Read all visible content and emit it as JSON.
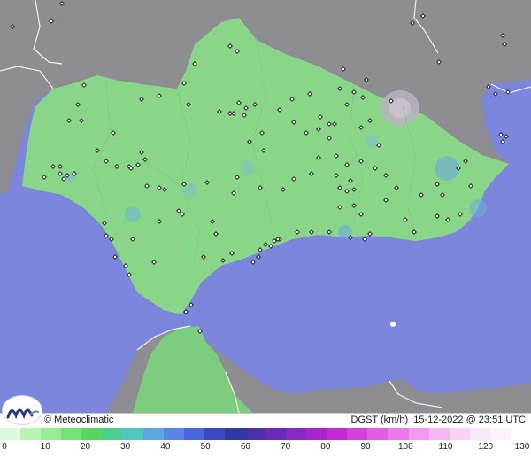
{
  "map": {
    "brand": "© Meteoclimatic",
    "variable": "DGST (km/h)",
    "datetime": "15-12-2022 @ 23:51 UTC",
    "colors": {
      "sea": "#7b86dc",
      "land_foreign": "#8d8d92",
      "land_main": "#8ad688",
      "hill_gray": "#b9b4bf",
      "border": "#f2f2f2",
      "station": "#1a1a1a"
    }
  },
  "legend": {
    "ticks": [
      "0",
      "10",
      "20",
      "30",
      "40",
      "50",
      "60",
      "70",
      "80",
      "90",
      "100",
      "110",
      "120",
      "130"
    ],
    "colors": [
      "#dcfadb",
      "#b9f4b5",
      "#96ec92",
      "#74e275",
      "#58d65f",
      "#4ccf8a",
      "#54c7c1",
      "#5aa9e4",
      "#5a86ea",
      "#4c63e0",
      "#3a48c4",
      "#2f39a6",
      "#4a2fa8",
      "#6a2bb8",
      "#8a28c4",
      "#a824ce",
      "#c22ad8",
      "#d640de",
      "#e25ce4",
      "#ec7aea",
      "#f298ee",
      "#f6b6f2",
      "#f9d2f6",
      "#fbe6f9",
      "#fdf2fc",
      "#ffffff"
    ]
  }
}
